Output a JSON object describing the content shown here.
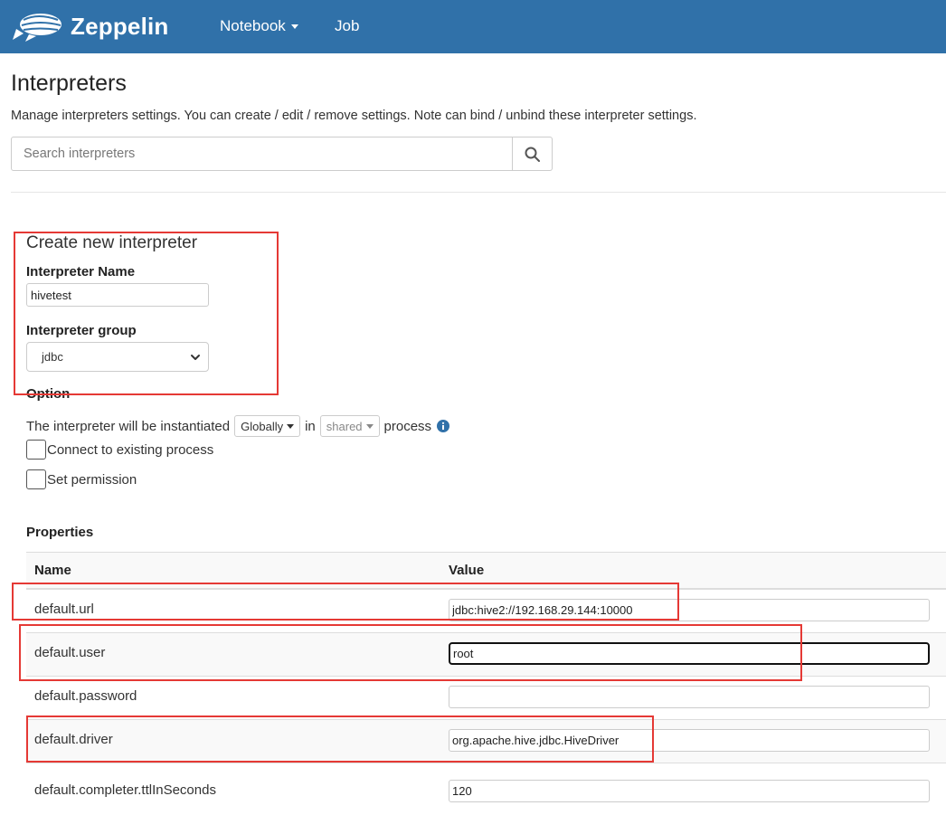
{
  "app": {
    "brand": "Zeppelin"
  },
  "nav": {
    "notebook": "Notebook",
    "job": "Job"
  },
  "header": {
    "title": "Interpreters",
    "description": "Manage interpreters settings. You can create / edit / remove settings. Note can bind / unbind these interpreter settings."
  },
  "search": {
    "placeholder": "Search interpreters"
  },
  "create": {
    "title": "Create new interpreter",
    "name_label": "Interpreter Name",
    "name_value": "hivetest",
    "group_label": "Interpreter group",
    "group_value": "jdbc"
  },
  "option": {
    "label": "Option",
    "prefix": "The interpreter will be instantiated",
    "scope": "Globally",
    "in": "in",
    "mode": "shared",
    "suffix": "process",
    "connect_label": "Connect to existing process",
    "permission_label": "Set permission"
  },
  "properties": {
    "title": "Properties",
    "col_name": "Name",
    "col_value": "Value",
    "rows": [
      {
        "name": "default.url",
        "value": "jdbc:hive2://192.168.29.144:10000"
      },
      {
        "name": "default.user",
        "value": "root"
      },
      {
        "name": "default.password",
        "value": ""
      },
      {
        "name": "default.driver",
        "value": "org.apache.hive.jdbc.HiveDriver"
      },
      {
        "name": "default.completer.ttlInSeconds",
        "value": "120"
      }
    ]
  },
  "colors": {
    "navbar": "#3071a9",
    "annotation": "#e53935",
    "info": "#3071a9"
  }
}
